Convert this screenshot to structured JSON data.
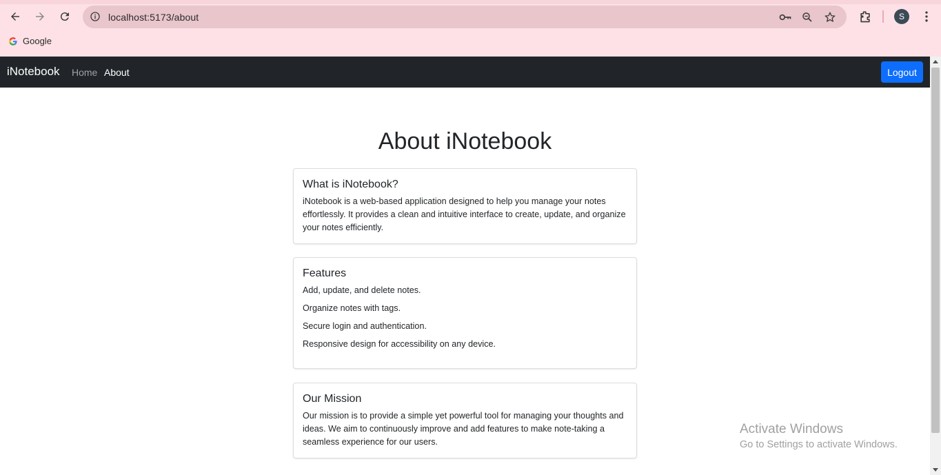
{
  "browser": {
    "url": "localhost:5173/about",
    "bookmarks": [
      {
        "label": "Google"
      }
    ],
    "profile_initial": "S",
    "icons": [
      "back-arrow-icon",
      "forward-arrow-icon",
      "reload-icon",
      "site-info-icon",
      "password-key-icon",
      "zoom-icon",
      "bookmark-star-icon",
      "extensions-icon",
      "menu-dots-icon"
    ]
  },
  "navbar": {
    "brand": "iNotebook",
    "links": [
      {
        "label": "Home",
        "active": false
      },
      {
        "label": "About",
        "active": true
      }
    ],
    "logout_label": "Logout",
    "colors": {
      "background": "#212529",
      "button": "#0d6efd"
    }
  },
  "main": {
    "title": "About iNotebook",
    "cards": [
      {
        "heading": "What is iNotebook?",
        "body": "iNotebook is a web-based application designed to help you manage your notes effortlessly. It provides a clean and intuitive interface to create, update, and organize your notes efficiently."
      },
      {
        "heading": "Features",
        "items": [
          "Add, update, and delete notes.",
          "Organize notes with tags.",
          "Secure login and authentication.",
          "Responsive design for accessibility on any device."
        ]
      },
      {
        "heading": "Our Mission",
        "body": "Our mission is to provide a simple yet powerful tool for managing your thoughts and ideas. We aim to continuously improve and add features to make note-taking a seamless experience for our users."
      }
    ]
  },
  "watermark": {
    "title": "Activate Windows",
    "subtitle": "Go to Settings to activate Windows."
  }
}
